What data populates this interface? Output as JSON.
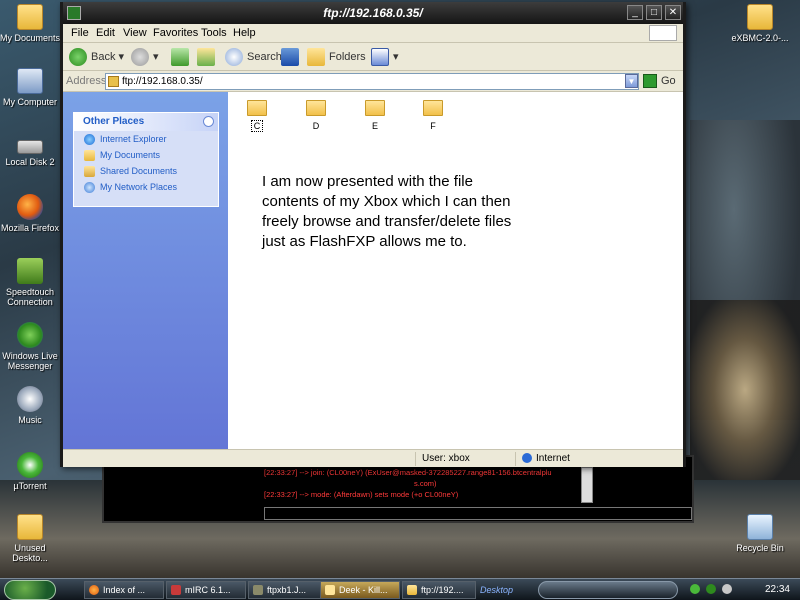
{
  "window": {
    "title": "ftp://192.168.0.35/"
  },
  "menu": [
    "File",
    "Edit",
    "View",
    "Favorites",
    "Tools",
    "Help"
  ],
  "toolbar": {
    "back": "Back",
    "search": "Search",
    "folders": "Folders"
  },
  "address": {
    "label": "Address",
    "value": "ftp://192.168.0.35/",
    "go": "Go"
  },
  "sidebar": {
    "panel_title": "Other Places",
    "links": [
      "Internet Explorer",
      "My Documents",
      "Shared Documents",
      "My Network Places"
    ]
  },
  "folders": [
    "C",
    "D",
    "E",
    "F"
  ],
  "note": "I am now presented with the file contents of my Xbox which I can then freely browse and transfer/delete files just as FlashFXP allows me to.",
  "status": {
    "user": "User: xbox",
    "zone": "Internet"
  },
  "desktop_icons": {
    "my_documents": "My Documents",
    "my_computer": "My Computer",
    "local_disk": "Local Disk 2",
    "firefox": "Mozilla Firefox",
    "speedtouch": "Speedtouch Connection",
    "messenger": "Windows Live Messenger",
    "music": "Music",
    "utorrent": "µTorrent",
    "unused": "Unused Deskto...",
    "xbmc": "eXBMC-2.0-...",
    "recycle": "Recycle Bin"
  },
  "mirc": {
    "line1": "[22:33:27]      --> join: (CL00neY) (ExUser@masked-372285227.range81-156.btcentralplu",
    "line1b": "s.com)",
    "line2": "[22:33:27]      --> mode: (Afterdawn) sets mode (+o CL00neY)"
  },
  "taskbar": {
    "tasks": [
      "Index of ...",
      "mIRC 6.1...",
      "ftpxb1.J...",
      "Deek - Kill...",
      "ftp://192...."
    ],
    "desktop": "Desktop",
    "clock": "22:34"
  }
}
